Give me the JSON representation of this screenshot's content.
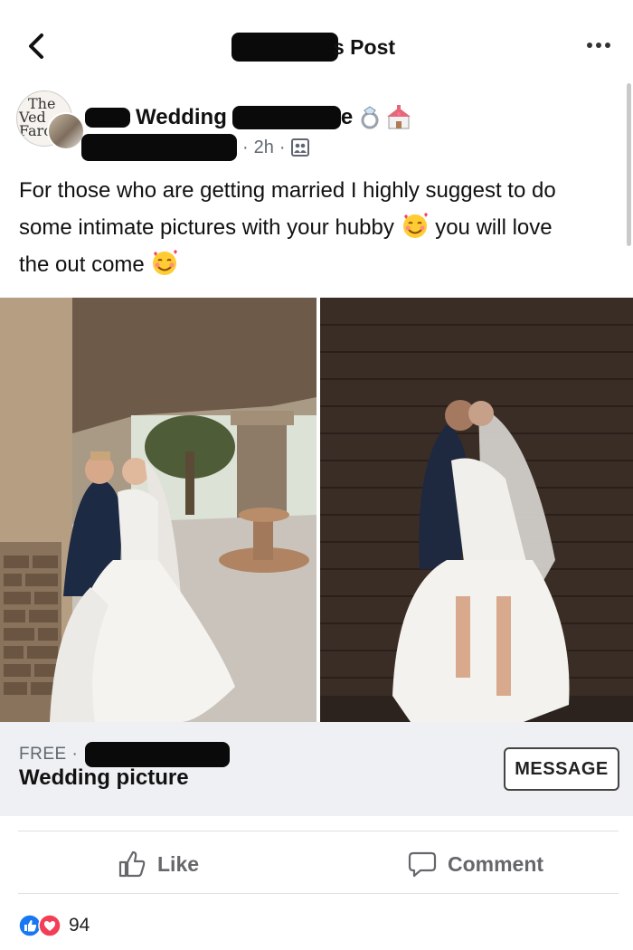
{
  "topbar": {
    "title": "s Post"
  },
  "post": {
    "avatar_logo_lines": [
      "The",
      "Ved",
      "Farc"
    ],
    "page_name": "Wedding",
    "page_name_tail": "e",
    "time": "2h",
    "dot": "·",
    "text_line1": "For those who are getting married I highly suggest to do",
    "text_line2a": "some intimate pictures with your hubby",
    "text_line2b": "you will love",
    "text_line3": "the out come"
  },
  "listing": {
    "price": "FREE ·",
    "title": "Wedding picture",
    "message_label": "MESSAGE"
  },
  "actions": {
    "like_label": "Like",
    "comment_label": "Comment"
  },
  "reactions": {
    "count": "94"
  },
  "colors": {
    "like_blue": "#1877f2",
    "love_red": "#f33e58",
    "redaction": "#0a0a0a"
  },
  "icons": [
    "back-arrow-icon",
    "more-dots-icon",
    "ring-emoji-icon",
    "wedding-chapel-emoji-icon",
    "audience-icon",
    "smiling-hearts-emoji-icon",
    "thumbs-up-icon",
    "comment-icon",
    "like-reaction-icon",
    "love-reaction-icon"
  ]
}
